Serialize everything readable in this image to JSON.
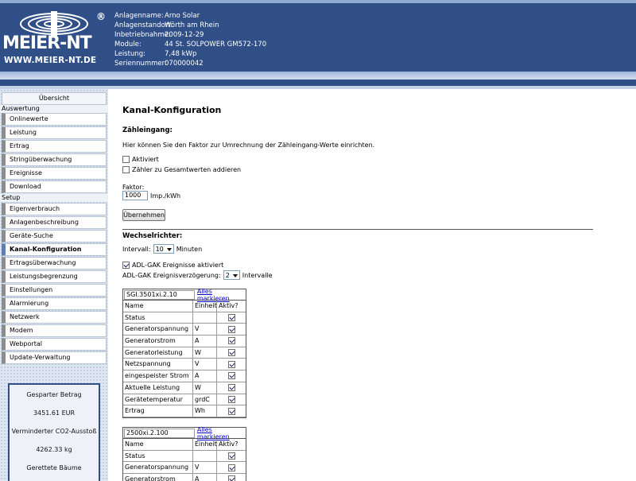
{
  "header": {
    "brand": "MEIER-NT",
    "url": "WWW.MEIER-NT.DE",
    "reg": "®",
    "info": [
      {
        "key": "Anlagenname:",
        "value": "Arno Solar"
      },
      {
        "key": "Anlagenstandort:",
        "value": "Wörth am Rhein"
      },
      {
        "key": "Inbetriebnahme:",
        "value": "2009-12-29"
      },
      {
        "key": "Module:",
        "value": "44 St. SOLPOWER GM572-170"
      },
      {
        "key": "Leistung:",
        "value": "7,48 kWp"
      },
      {
        "key": "Seriennummer:",
        "value": "070000042"
      }
    ]
  },
  "sidebar": {
    "overview": "Übersicht",
    "section_eval": "Auswertung",
    "eval_items": [
      "Onlinewerte",
      "Leistung",
      "Ertrag",
      "Stringüberwachung",
      "Ereignisse",
      "Download"
    ],
    "section_setup": "Setup",
    "setup_items": [
      "Eigenverbrauch",
      "Anlagenbeschreibung",
      "Geräte-Suche",
      "Kanal-Konfiguration",
      "Ertragsüberwachung",
      "Leistungsbegrenzung",
      "Einstellungen",
      "Alarmierung",
      "Netzwerk",
      "Modem",
      "Webportal",
      "Update-Verwaltung"
    ],
    "active": "Kanal-Konfiguration",
    "stats": {
      "saved_label": "Gesparter Betrag",
      "saved_value": "3451.61 EUR",
      "co2_label": "Verminderter CO2-Ausstoß",
      "co2_value": "4262.33 kg",
      "trees_label": "Gerettete Bäume"
    }
  },
  "main": {
    "title": "Kanal-Konfiguration",
    "counter": {
      "heading": "Zähleingang:",
      "description": "Hier können Sie den Faktor zur Umrechnung der Zähleingang-Werte einrichten.",
      "active_label": "Aktiviert",
      "total_label": "Zähler zu Gesamtwerten addieren",
      "factor_label": "Faktor:",
      "factor_value": "1000",
      "factor_unit": "Imp./kWh",
      "apply_label": "Übernehmen"
    },
    "inverter": {
      "heading": "Wechselrichter:",
      "interval_label": "Intervall:",
      "interval_value": "10",
      "interval_unit": "Minuten",
      "adl_label": "ADL-GAK Ereignisse aktiviert",
      "delay_label": "ADL-GAK Ereignisverzögerung:",
      "delay_value": "2",
      "delay_unit": "Intervalle"
    },
    "table_headers": {
      "name": "Name",
      "unit": "Einheit",
      "active": "Aktiv?"
    },
    "mark_all": "Alles markieren",
    "devices": [
      {
        "name": "SGI.3501xi.2.10",
        "channels": [
          {
            "name": "Status",
            "unit": "",
            "active": true
          },
          {
            "name": "Generatorspannung",
            "unit": "V",
            "active": true
          },
          {
            "name": "Generatorstrom",
            "unit": "A",
            "active": true
          },
          {
            "name": "Generatorleistung",
            "unit": "W",
            "active": true
          },
          {
            "name": "Netzspannung",
            "unit": "V",
            "active": true
          },
          {
            "name": "eingespeister Strom",
            "unit": "A",
            "active": true
          },
          {
            "name": "Aktuelle Leistung",
            "unit": "W",
            "active": true
          },
          {
            "name": "Gerätetemperatur",
            "unit": "grdC",
            "active": true
          },
          {
            "name": "Ertrag",
            "unit": "Wh",
            "active": true
          }
        ]
      },
      {
        "name": "2500xi.2.100",
        "channels": [
          {
            "name": "Status",
            "unit": "",
            "active": true
          },
          {
            "name": "Generatorspannung",
            "unit": "V",
            "active": true
          },
          {
            "name": "Generatorstrom",
            "unit": "A",
            "active": true
          }
        ]
      }
    ]
  }
}
